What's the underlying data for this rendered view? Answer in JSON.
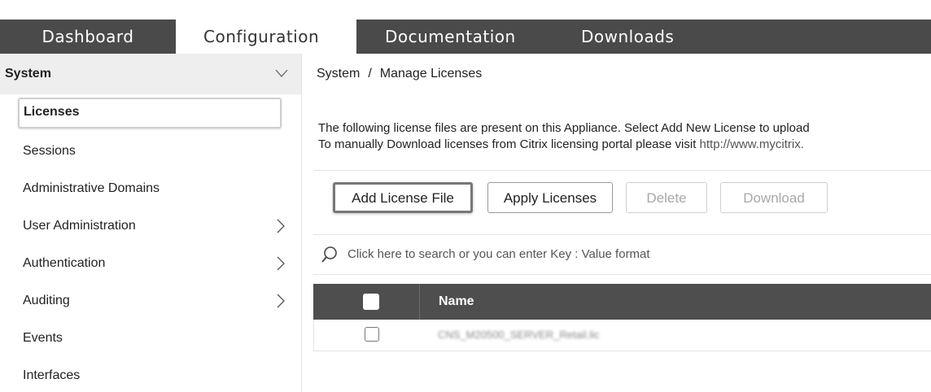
{
  "top_cut_text": {
    "prefix": "",
    "bold": ""
  },
  "nav": {
    "tabs": [
      {
        "label": "Dashboard"
      },
      {
        "label": "Configuration"
      },
      {
        "label": "Documentation"
      },
      {
        "label": "Downloads"
      }
    ],
    "active_tab": "Configuration"
  },
  "sidebar": {
    "section_title": "System",
    "items": [
      {
        "label": "Licenses",
        "selected": true
      },
      {
        "label": "Sessions"
      },
      {
        "label": "Administrative Domains"
      },
      {
        "label": "User Administration",
        "has_children": true
      },
      {
        "label": "Authentication",
        "has_children": true
      },
      {
        "label": "Auditing",
        "has_children": true
      },
      {
        "label": "Events"
      },
      {
        "label": "Interfaces"
      }
    ]
  },
  "main": {
    "breadcrumb": {
      "parent": "System",
      "separator": "/",
      "current": "Manage Licenses"
    },
    "description_line1": "The following license files are present on this Appliance. Select Add New License to upload",
    "description_line2_prefix": "To manually Download licenses from Citrix licensing portal please visit",
    "description_link": "http://www.mycitrix.",
    "toolbar": {
      "add_label": "Add License File",
      "apply_label": "Apply Licenses",
      "delete_label": "Delete",
      "download_label": "Download"
    },
    "search": {
      "placeholder": "Click here to search or you can enter Key : Value format"
    },
    "table": {
      "columns": [
        "Name"
      ],
      "rows": [
        {
          "name": "CNS_M20500_SERVER_Retail.lic"
        }
      ]
    }
  },
  "colors": {
    "nav_bg": "#4a4a4a",
    "table_header_bg": "#4e4e4e",
    "sidebar_header_bg": "#eeeeee"
  }
}
